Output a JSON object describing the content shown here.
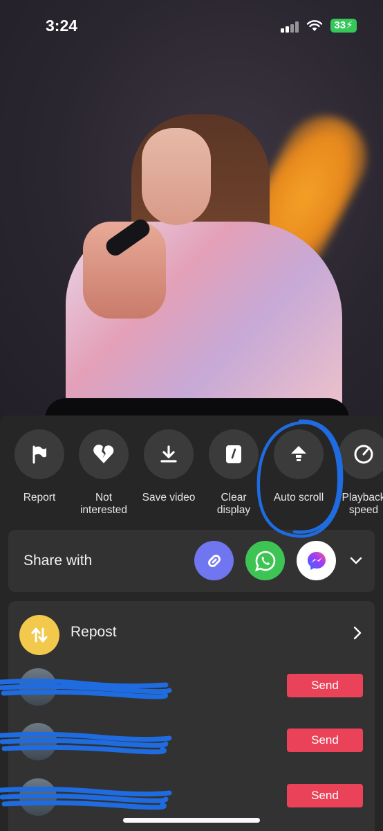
{
  "status_bar": {
    "time": "3:24",
    "battery": "33"
  },
  "actions": [
    {
      "label_line1": "Report",
      "label_line2": "",
      "icon": "flag-icon"
    },
    {
      "label_line1": "Not",
      "label_line2": "interested",
      "icon": "broken-heart-icon"
    },
    {
      "label_line1": "Save video",
      "label_line2": "",
      "icon": "download-icon"
    },
    {
      "label_line1": "Clear",
      "label_line2": "display",
      "icon": "clear-display-icon"
    },
    {
      "label_line1": "Auto scroll",
      "label_line2": "",
      "icon": "arrow-up-icon"
    },
    {
      "label_line1": "Playback",
      "label_line2": "speed",
      "icon": "speedometer-icon"
    }
  ],
  "share": {
    "title": "Share with",
    "targets": [
      "copy-link",
      "whatsapp",
      "messenger"
    ]
  },
  "repost": {
    "label": "Repost"
  },
  "contacts": [
    {
      "send_label": "Send"
    },
    {
      "send_label": "Send"
    },
    {
      "send_label": "Send"
    }
  ],
  "colors": {
    "sheet_bg": "#262626",
    "card_bg": "#323232",
    "send": "#ea4359",
    "link_btn": "#6f76f0",
    "whatsapp": "#3ec454",
    "repost": "#f2c94c",
    "annotation": "#1f6be0"
  }
}
